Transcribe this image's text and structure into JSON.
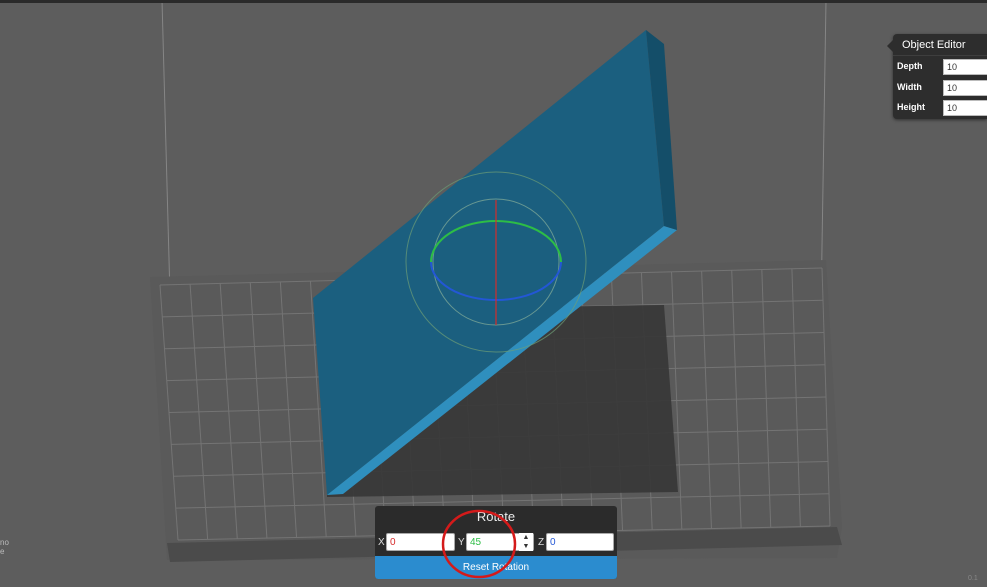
{
  "object_editor": {
    "title": "Object Editor",
    "fields": [
      {
        "label": "Depth",
        "value": "10"
      },
      {
        "label": "Width",
        "value": "10"
      },
      {
        "label": "Height",
        "value": "10"
      }
    ]
  },
  "rotate": {
    "title": "Rotate",
    "x_label": "X",
    "x_value": "0",
    "y_label": "Y",
    "y_value": "45",
    "z_label": "Z",
    "z_value": "0",
    "reset_label": "Reset Rotation"
  },
  "left_hint": [
    "no",
    "e"
  ],
  "corner_hint": "0.1",
  "colors": {
    "background": "#5d5d5d",
    "object_top": "#1b5f7f",
    "object_edge": "#2f8fbe",
    "x_axis": "#d62a2a",
    "y_axis": "#2dbd46",
    "z_axis": "#2357d6",
    "reset_button": "#2b8ccf",
    "annotation_circle": "#d41a1a"
  }
}
